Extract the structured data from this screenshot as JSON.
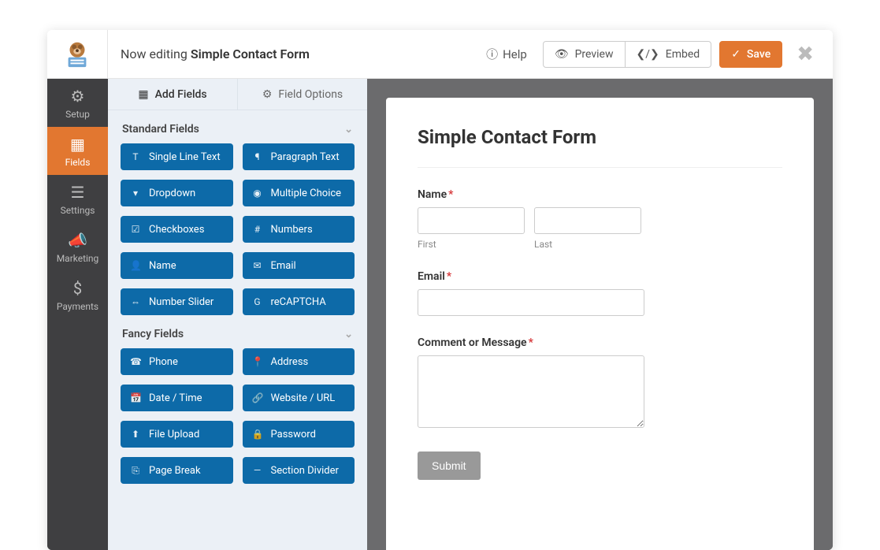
{
  "header": {
    "editing_prefix": "Now editing",
    "form_name": "Simple Contact Form",
    "help": "Help",
    "preview": "Preview",
    "embed": "Embed",
    "save": "Save"
  },
  "rail": {
    "items": [
      {
        "label": "Setup",
        "icon": "⚙"
      },
      {
        "label": "Fields",
        "icon": "▦",
        "active": true
      },
      {
        "label": "Settings",
        "icon": "☰"
      },
      {
        "label": "Marketing",
        "icon": "📣"
      },
      {
        "label": "Payments",
        "icon": "$"
      }
    ]
  },
  "panel": {
    "tabs": {
      "add_fields": "Add Fields",
      "field_options": "Field Options"
    },
    "groups": [
      {
        "title": "Standard Fields",
        "fields": [
          {
            "icon": "T",
            "label": "Single Line Text"
          },
          {
            "icon": "¶",
            "label": "Paragraph Text"
          },
          {
            "icon": "▾",
            "label": "Dropdown"
          },
          {
            "icon": "◉",
            "label": "Multiple Choice"
          },
          {
            "icon": "☑",
            "label": "Checkboxes"
          },
          {
            "icon": "#",
            "label": "Numbers"
          },
          {
            "icon": "👤",
            "label": "Name"
          },
          {
            "icon": "✉",
            "label": "Email"
          },
          {
            "icon": "⇔",
            "label": "Number Slider"
          },
          {
            "icon": "G",
            "label": "reCAPTCHA"
          }
        ]
      },
      {
        "title": "Fancy Fields",
        "fields": [
          {
            "icon": "☎",
            "label": "Phone"
          },
          {
            "icon": "📍",
            "label": "Address"
          },
          {
            "icon": "📅",
            "label": "Date / Time"
          },
          {
            "icon": "🔗",
            "label": "Website / URL"
          },
          {
            "icon": "⬆",
            "label": "File Upload"
          },
          {
            "icon": "🔒",
            "label": "Password"
          },
          {
            "icon": "⎘",
            "label": "Page Break"
          },
          {
            "icon": "—",
            "label": "Section Divider"
          }
        ]
      }
    ]
  },
  "preview": {
    "title": "Simple Contact Form",
    "name_label": "Name",
    "first_sub": "First",
    "last_sub": "Last",
    "email_label": "Email",
    "comment_label": "Comment or Message",
    "submit": "Submit"
  }
}
